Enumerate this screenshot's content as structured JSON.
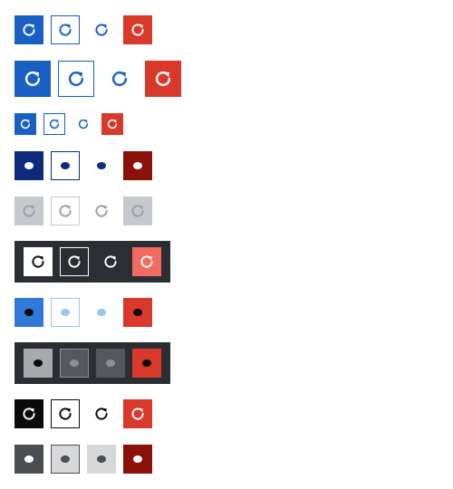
{
  "icon_name": "refresh-icon",
  "state_icon_name": "dot-icon",
  "colors": {
    "primary": "#1a5fc4",
    "danger": "#d9392b",
    "selected_primary": "#0d2a7c",
    "selected_danger": "#8a1208",
    "disabled": "#c5c8cc",
    "disabled_icon": "#9aa0a6",
    "dark_bg": "#2b2f33",
    "hover_primary": "#2f7ad8",
    "hover_secondary_icon": "#9cc7f2",
    "black": "#0a0a0a",
    "gray": "#4a4d52",
    "light_gray": "#d6d8da",
    "coral": "#f16b63"
  },
  "rows": [
    {
      "id": "default-md",
      "variants": [
        "primary",
        "secondary",
        "ghost",
        "danger"
      ],
      "state": "default",
      "theme": "light"
    },
    {
      "id": "default-lg",
      "variants": [
        "primary",
        "secondary",
        "ghost",
        "danger"
      ],
      "state": "default",
      "theme": "light"
    },
    {
      "id": "default-sm",
      "variants": [
        "primary",
        "secondary",
        "ghost",
        "danger"
      ],
      "state": "default",
      "theme": "light"
    },
    {
      "id": "selected",
      "variants": [
        "primary",
        "secondary",
        "ghost",
        "danger"
      ],
      "state": "selected",
      "theme": "light"
    },
    {
      "id": "disabled",
      "variants": [
        "primary",
        "secondary",
        "ghost",
        "danger"
      ],
      "state": "disabled",
      "theme": "light"
    },
    {
      "id": "inverse-default",
      "variants": [
        "primary",
        "secondary",
        "ghost",
        "danger"
      ],
      "state": "default",
      "theme": "dark"
    },
    {
      "id": "hover",
      "variants": [
        "primary",
        "secondary",
        "ghost",
        "danger"
      ],
      "state": "hover",
      "theme": "light"
    },
    {
      "id": "inverse-hover",
      "variants": [
        "primary",
        "secondary",
        "ghost",
        "danger"
      ],
      "state": "hover",
      "theme": "dark"
    },
    {
      "id": "monochrome-default",
      "variants": [
        "primary",
        "secondary",
        "ghost",
        "danger"
      ],
      "state": "default",
      "theme": "mono"
    },
    {
      "id": "monochrome-pressed",
      "variants": [
        "primary",
        "secondary",
        "ghost",
        "danger"
      ],
      "state": "pressed",
      "theme": "mono"
    }
  ]
}
